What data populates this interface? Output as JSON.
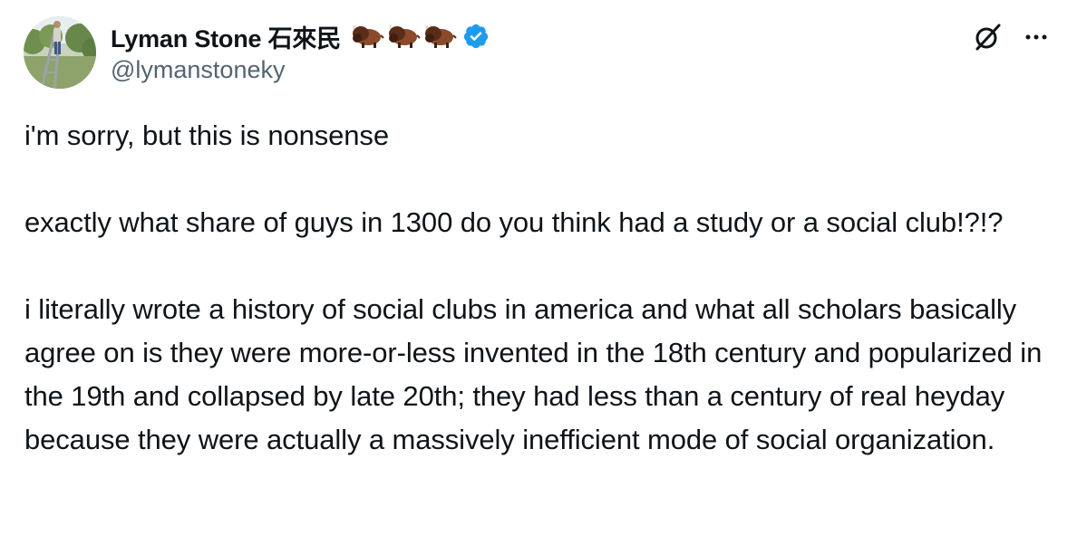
{
  "author": {
    "display_name": "Lyman Stone 石來民",
    "handle": "@lymanstoneky",
    "emoji_badges": [
      "bison-icon",
      "bison-icon",
      "bison-icon"
    ],
    "verified": true
  },
  "actions": {
    "grok_icon": "grok-icon",
    "more_icon": "more-icon"
  },
  "tweet": {
    "paragraphs": [
      "i'm sorry, but this is nonsense",
      "exactly what share of guys in 1300 do you think had a study or a social club!?!?",
      "i literally wrote a history of social clubs in america and what all scholars basically agree on is they were more-or-less invented in the 18th century and popularized in the 19th and collapsed by late 20th; they had less than a century of real heyday because they were actually a massively inefficient mode of social organization."
    ]
  },
  "colors": {
    "text": "#0f1419",
    "secondary_text": "#536471",
    "verified_blue": "#1d9bf0"
  }
}
